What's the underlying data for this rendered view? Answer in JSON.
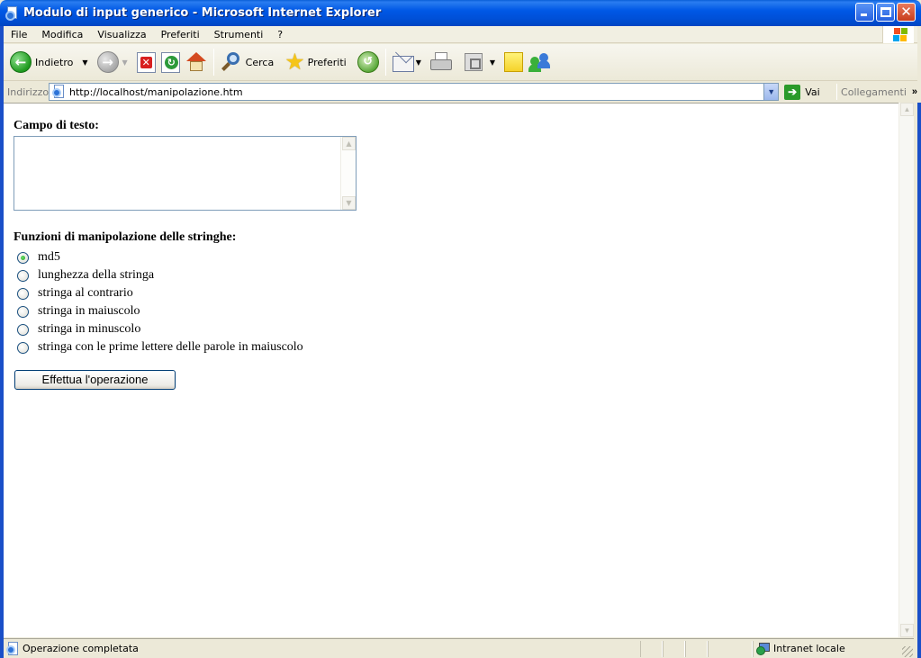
{
  "window": {
    "title": "Modulo di input generico - Microsoft Internet Explorer"
  },
  "menu": {
    "items": [
      "File",
      "Modifica",
      "Visualizza",
      "Preferiti",
      "Strumenti",
      "?"
    ]
  },
  "toolbar": {
    "back_label": "Indietro",
    "search_label": "Cerca",
    "favorites_label": "Preferiti"
  },
  "address": {
    "label": "Indirizzo",
    "url": "http://localhost/manipolazione.htm",
    "go_label": "Vai",
    "links_label": "Collegamenti"
  },
  "form": {
    "text_field_label": "Campo di testo:",
    "text_field_value": "",
    "functions_label": "Funzioni di manipolazione delle stringhe:",
    "options": [
      {
        "label": "md5",
        "checked": true
      },
      {
        "label": "lunghezza della stringa",
        "checked": false
      },
      {
        "label": "stringa al contrario",
        "checked": false
      },
      {
        "label": "stringa in maiuscolo",
        "checked": false
      },
      {
        "label": "stringa in minuscolo",
        "checked": false
      },
      {
        "label": "stringa con le prime lettere delle parole in maiuscolo",
        "checked": false
      }
    ],
    "submit_label": "Effettua l'operazione"
  },
  "status": {
    "text": "Operazione completata",
    "zone": "Intranet locale"
  }
}
